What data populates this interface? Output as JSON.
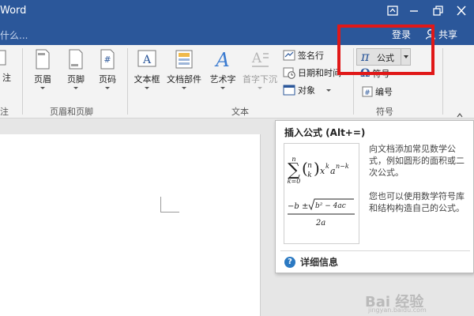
{
  "window": {
    "title": "Word",
    "restore_icon": "ribbon-display-icon",
    "accent": "#2b579a"
  },
  "tellbar": {
    "tell_text": "什么...",
    "login": "登录",
    "share": "共享"
  },
  "ribbon": {
    "partial_left": {
      "label": "注",
      "group_label": "注"
    },
    "header_footer": {
      "buttons": [
        {
          "label": "页眉",
          "icon": "header-icon"
        },
        {
          "label": "页脚",
          "icon": "footer-icon"
        },
        {
          "label": "页码",
          "icon": "page-number-icon"
        }
      ],
      "group_label": "页眉和页脚"
    },
    "text": {
      "buttons": [
        {
          "label": "文本框",
          "icon": "textbox-icon"
        },
        {
          "label": "文档部件",
          "icon": "quick-parts-icon"
        },
        {
          "label": "艺术字",
          "icon": "wordart-icon"
        },
        {
          "label": "首字下沉",
          "icon": "drop-cap-icon"
        }
      ],
      "small_buttons": [
        {
          "label": "签名行",
          "icon": "signature-line-icon"
        },
        {
          "label": "日期和时间",
          "icon": "date-time-icon"
        },
        {
          "label": "对象",
          "icon": "object-icon"
        }
      ],
      "group_label": "文本"
    },
    "symbols": {
      "formula_label": "公式",
      "formula_icon": "pi-icon",
      "symbol_label": "符号",
      "symbol_icon": "omega-icon",
      "numbering_label": "编号",
      "numbering_icon": "numbering-icon",
      "group_label": "符号"
    },
    "highlight_color": "#e01818"
  },
  "tooltip": {
    "title": "插入公式 (Alt+=)",
    "desc1": "向文档添加常见数学公式，例如圆形的面积或二次公式。",
    "desc2": "您也可以使用数学符号库和结构构造自己的公式。",
    "more": "详细信息",
    "formula_image": {
      "sum_upper": "n",
      "sum_lower": "k=0",
      "binom_top": "n",
      "binom_bottom": "k",
      "x": "x",
      "x_exp": "k",
      "a": "a",
      "a_exp": "n−k",
      "quad_num_prefix": "−b ±",
      "quad_sqrt": "b² − 4ac",
      "quad_den": "2a"
    }
  },
  "watermark": {
    "text": "Bai 经验",
    "sub": "jingyan.baidu.com"
  }
}
